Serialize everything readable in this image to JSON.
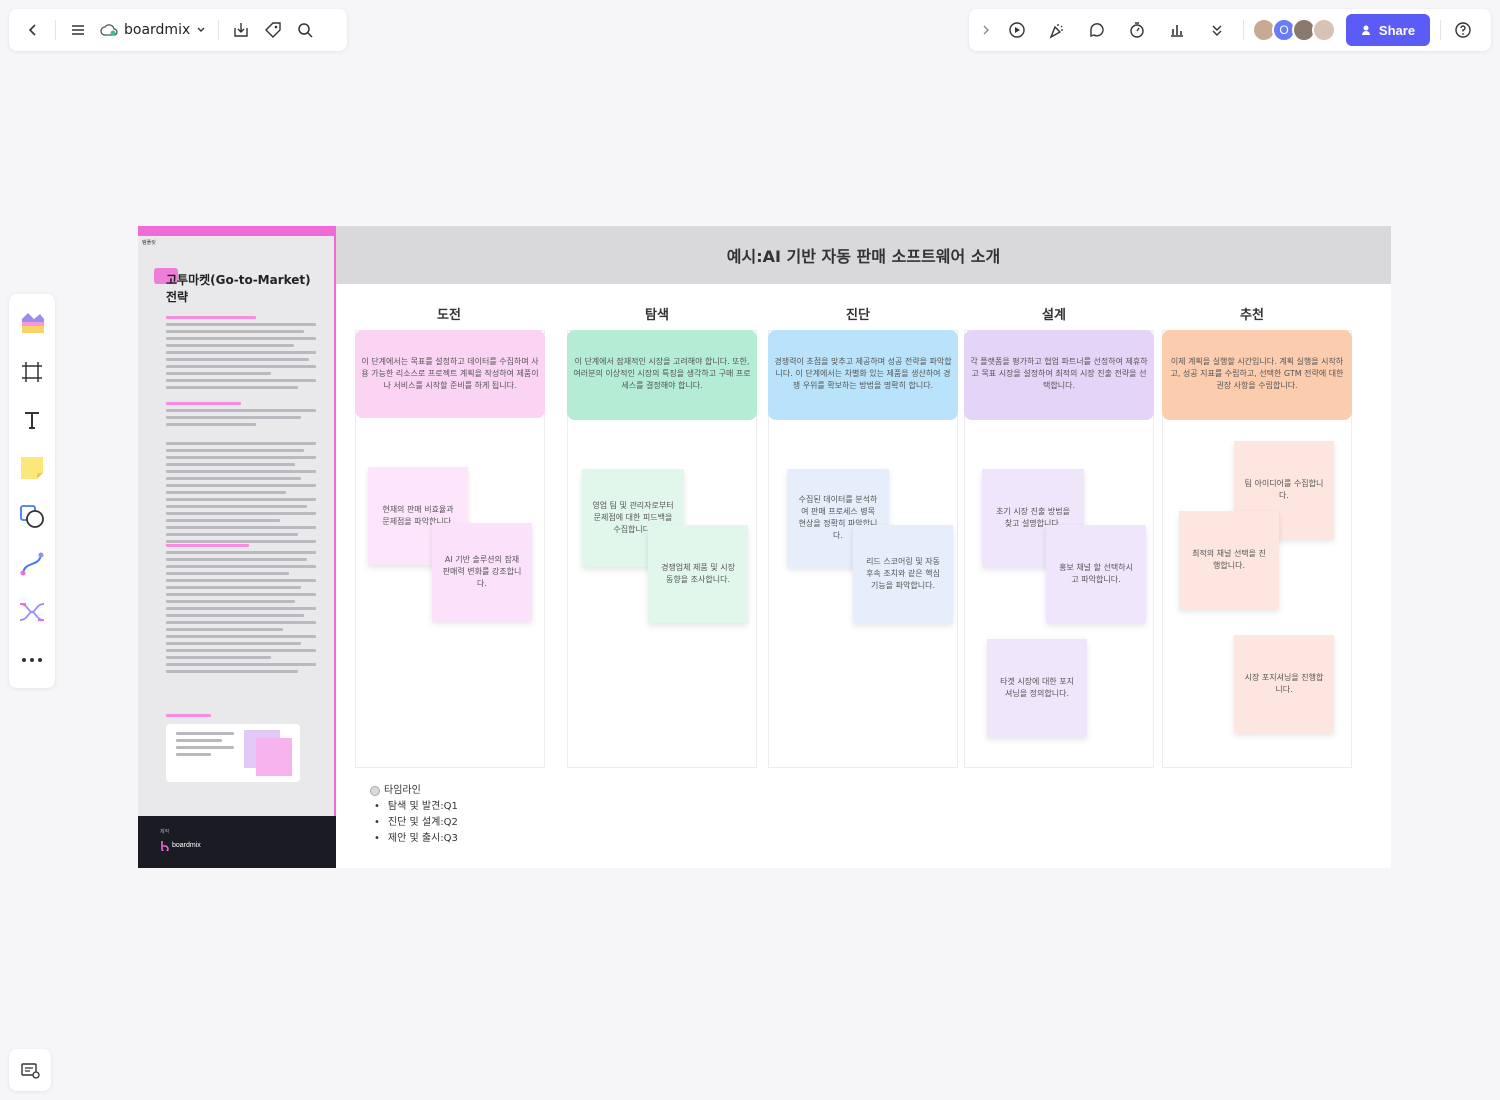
{
  "toolbar_left": {
    "app_name": "boardmix"
  },
  "toolbar_right": {
    "share_label": "Share",
    "avatar_initial": "O"
  },
  "board": {
    "main_title": "예시:AI 기반 자동 판매 소프트웨어 소개",
    "sidebar": {
      "tag": "템플릿",
      "title": "고투마켓(Go-to-Market) 전략",
      "footer_label": "제작",
      "footer_logo": "boardmix"
    },
    "columns": [
      {
        "title": "도전",
        "head_text": "이 단계에서는 목표를 설정하고 데이터를 수집하며 사용 가능한 리소스로 프로젝트 계획을 작성하여 제품이나 서비스를 시작할 준비를 하게 됩니다.",
        "head_color": "#fbd3f3",
        "stickies": [
          {
            "text": "현재의 판매 비효율과 문제점을 파악합니다.",
            "color": "#fde6fb"
          },
          {
            "text": "AI 기반 솔루션의 잠재 판매력 변화를 강조합니다.",
            "color": "#fce1fa"
          }
        ]
      },
      {
        "title": "탐색",
        "head_text": "이 단계에서 잠재적인 시장을 고려해야 합니다. 또한, 여러분의 이상적인 시장의 특징을 생각하고 구매 프로세스를 결정해야 합니다.",
        "head_color": "#b4ecd6",
        "stickies": [
          {
            "text": "영업 팀 및 관리자로부터 문제점에 대한 피드백을 수집합니다.",
            "color": "#e1f7ec"
          },
          {
            "text": "경쟁업체 제품 및 시장 동향을 조사합니다.",
            "color": "#e1f7ec"
          }
        ]
      },
      {
        "title": "진단",
        "head_text": "경쟁력이 초점을 맞추고 제공하며 성공 전략을 파악합니다. 이 단계에서는 차별화 있는 제품을 생산하여 경쟁 우위를 확보하는 방법을 명확히 합니다.",
        "head_color": "#b9e3fa",
        "stickies": [
          {
            "text": "수집된 데이터를 분석하여 판매 프로세스 병목 현상을 정확히 파악합니다.",
            "color": "#e6eefb"
          },
          {
            "text": "리드 스코어링 및 자동 후속 조치와 같은 핵심 기능을 파악합니다.",
            "color": "#e6eefb"
          }
        ]
      },
      {
        "title": "설계",
        "head_text": "각 플랫폼을 평가하고 협업 파트너를 선정하여 제휴하고 목표 시장을 설정하여 최적의 시장 진출 전략을 선택합니다.",
        "head_color": "#e4d4f8",
        "stickies": [
          {
            "text": "초기 시장 진출 방법을 찾고 설명합니다.",
            "color": "#efe6fb"
          },
          {
            "text": "홍보 채널 할 선택하시고 파악합니다.",
            "color": "#efe6fb"
          },
          {
            "text": "타겟 시장에 대한 포지셔닝을 정의합니다.",
            "color": "#efe6fb"
          }
        ]
      },
      {
        "title": "추천",
        "head_text": "이제 계획을 실행할 시간입니다. 계획 실행을 시작하고, 성공 지표를 수립하고, 선택한 GTM 전략에 대한 권장 사항을 수립합니다.",
        "head_color": "#fcccae",
        "stickies": [
          {
            "text": "팀 아이디어를 수집합니다.",
            "color": "#fde6e0"
          },
          {
            "text": "최적의 채널 선택을 진행합니다.",
            "color": "#fde6e0"
          },
          {
            "text": "시장 포지셔닝을 진행합니다.",
            "color": "#fde6e0"
          }
        ]
      }
    ],
    "timeline": {
      "title": "타임라인",
      "items": [
        "탐색 및 발견:Q1",
        "진단 및 설계:Q2",
        "제안 및 출시:Q3"
      ]
    }
  }
}
